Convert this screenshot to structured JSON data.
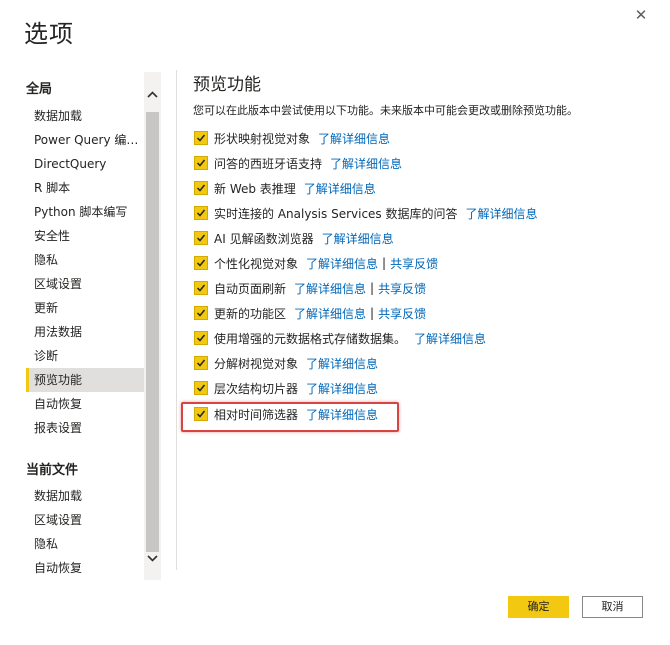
{
  "dialog": {
    "title": "选项",
    "close_icon": "close-icon"
  },
  "sidebar": {
    "global_title": "全局",
    "global_items": [
      {
        "label": "数据加载"
      },
      {
        "label": "Power Query 编辑..."
      },
      {
        "label": "DirectQuery"
      },
      {
        "label": "R 脚本"
      },
      {
        "label": "Python 脚本编写"
      },
      {
        "label": "安全性"
      },
      {
        "label": "隐私"
      },
      {
        "label": "区域设置"
      },
      {
        "label": "更新"
      },
      {
        "label": "用法数据"
      },
      {
        "label": "诊断"
      },
      {
        "label": "预览功能",
        "selected": true
      },
      {
        "label": "自动恢复"
      },
      {
        "label": "报表设置"
      }
    ],
    "current_title": "当前文件",
    "current_items": [
      {
        "label": "数据加载"
      },
      {
        "label": "区域设置"
      },
      {
        "label": "隐私"
      },
      {
        "label": "自动恢复"
      }
    ]
  },
  "main": {
    "title": "预览功能",
    "description": "您可以在此版本中尝试使用以下功能。未来版本中可能会更改或删除预览功能。",
    "features": [
      {
        "label": "形状映射视觉对象",
        "link": "了解详细信息",
        "checked": true
      },
      {
        "label": "问答的西班牙语支持",
        "link": "了解详细信息",
        "checked": true
      },
      {
        "label": "新 Web 表推理",
        "link": "了解详细信息",
        "checked": true
      },
      {
        "label": "实时连接的 Analysis Services 数据库的问答",
        "link": "了解详细信息",
        "checked": true
      },
      {
        "label": "AI 见解函数浏览器",
        "link": "了解详细信息",
        "checked": true
      },
      {
        "label": "个性化视觉对象",
        "link": "了解详细信息",
        "sep": "|",
        "link2": "共享反馈",
        "checked": true
      },
      {
        "label": "自动页面刷新",
        "link": "了解详细信息",
        "sep": "|",
        "link2": "共享反馈",
        "checked": true
      },
      {
        "label": "更新的功能区",
        "link": "了解详细信息",
        "sep": "|",
        "link2": "共享反馈",
        "checked": true
      },
      {
        "label": "使用增强的元数据格式存储数据集。",
        "link": "了解详细信息",
        "checked": true
      },
      {
        "label": "分解树视觉对象",
        "link": "了解详细信息",
        "checked": true
      },
      {
        "label": "层次结构切片器",
        "link": "了解详细信息",
        "checked": true
      },
      {
        "label": "相对时间筛选器",
        "link": "了解详细信息",
        "checked": true
      }
    ]
  },
  "buttons": {
    "ok": "确定",
    "cancel": "取消"
  },
  "colors": {
    "accent": "#f2c811",
    "link": "#0067b8",
    "highlight": "#d64541"
  }
}
